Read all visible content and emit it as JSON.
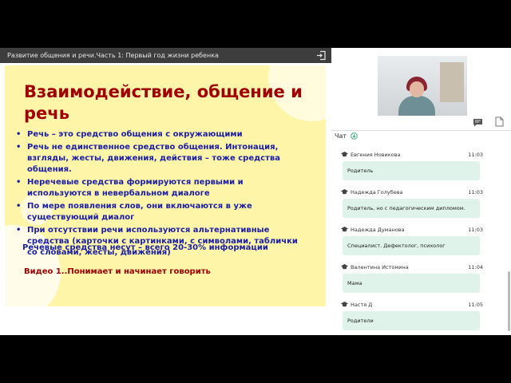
{
  "presentation": {
    "title": "Развитие общения и речи.Часть 1: Первый год жизни ребенка",
    "slide": {
      "heading_line1": "Взаимодействие, общение и",
      "heading_line2": "речь",
      "bullets": [
        {
          "lines": [
            "Речь – это средство общения  с окружающими"
          ]
        },
        {
          "lines": [
            "Речь не единственное средство общения. Интонация,",
            "взгляды, жесты, движения, действия – тоже средства",
            "общения."
          ]
        },
        {
          "lines": [
            "Неречевые средства формируются первыми и",
            "используются в невербальном диалоге"
          ]
        },
        {
          "lines": [
            "По мере появления слов, они включаются в уже",
            "существующий диалог"
          ]
        },
        {
          "lines": [
            " При отсутствии речи используются альтернативные",
            "средства (карточки с картинками, с символами, таблички",
            "со словами, жесты, движения)"
          ]
        }
      ],
      "summary": "Речевые  средства несут  – всего 20-30% информации",
      "video": "Видео 1..Понимает и начинает говорить"
    }
  },
  "chat": {
    "label": "Чат",
    "messages": [
      {
        "name": "Евгения Новикова",
        "time": "11:03",
        "text": "Родитель"
      },
      {
        "name": "Надежда Голубева",
        "time": "11:03",
        "text": "Родитель, но с педагогическим дипломом."
      },
      {
        "name": "Надежда Думанова",
        "time": "11:03",
        "text": "Специалист. Дефектолог, психолог"
      },
      {
        "name": "Валентина Истомина",
        "time": "11:04",
        "text": "Мама"
      },
      {
        "name": "Настя Д",
        "time": "11:05",
        "text": "Родители"
      }
    ]
  },
  "icons": {
    "exit": "exit-presentation-icon",
    "chat": "chat-icon",
    "notes": "notes-icon",
    "down": "arrow-down-circle-icon",
    "role": "graduation-cap-icon"
  }
}
